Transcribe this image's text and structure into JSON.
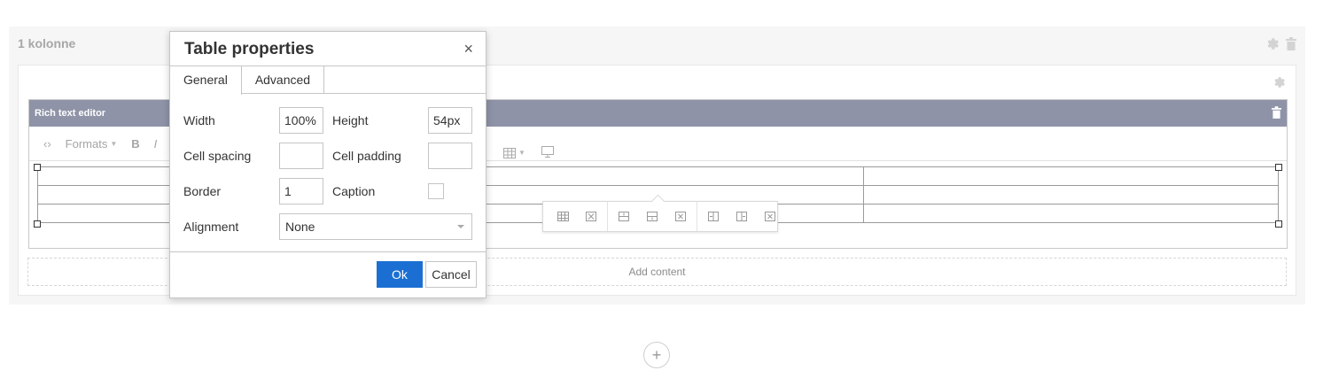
{
  "grid": {
    "row_label": "1 kolonne",
    "add_content": "Add content"
  },
  "editor": {
    "header_title": "Rich text editor",
    "toolbar": {
      "source_glyph": "‹›",
      "formats_label": "Formats",
      "bold_label": "B",
      "italic_label": "I"
    }
  },
  "dialog": {
    "title": "Table properties",
    "close_glyph": "×",
    "tabs": [
      {
        "label": "General",
        "active": true
      },
      {
        "label": "Advanced",
        "active": false
      }
    ],
    "fields": {
      "width_label": "Width",
      "width_value": "100%",
      "height_label": "Height",
      "height_value": "54px",
      "cell_spacing_label": "Cell spacing",
      "cell_spacing_value": "",
      "cell_padding_label": "Cell padding",
      "cell_padding_value": "",
      "border_label": "Border",
      "border_value": "1",
      "caption_label": "Caption",
      "caption_checked": false,
      "alignment_label": "Alignment",
      "alignment_value": "None"
    },
    "ok_label": "Ok",
    "cancel_label": "Cancel"
  },
  "table": {
    "rows": 3,
    "columns": 3
  },
  "colors": {
    "header_bg": "#8e93a7",
    "primary_button": "#1b6fd2"
  },
  "icons": {
    "row_settings": "gear-icon",
    "row_delete": "trash-icon",
    "area_settings": "gear-icon",
    "editor_delete": "trash-icon",
    "add_row": "plus-icon"
  }
}
